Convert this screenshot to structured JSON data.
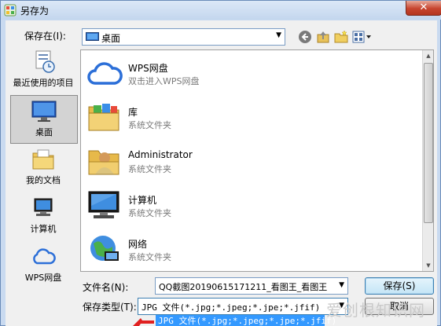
{
  "window": {
    "title": "另存为",
    "close_label": "✕"
  },
  "save_in": {
    "label": "保存在(I):",
    "value": "桌面"
  },
  "toolbar": {
    "back": "back-icon",
    "up": "up-folder-icon",
    "new_folder": "new-folder-icon",
    "view": "view-menu-icon"
  },
  "places": [
    {
      "label": "最近使用的项目",
      "icon": "recent-items-icon"
    },
    {
      "label": "桌面",
      "icon": "desktop-icon",
      "selected": true
    },
    {
      "label": "我的文档",
      "icon": "documents-icon"
    },
    {
      "label": "计算机",
      "icon": "computer-icon"
    },
    {
      "label": "WPS网盘",
      "icon": "wps-cloud-icon"
    }
  ],
  "files": [
    {
      "name": "WPS网盘",
      "desc": "双击进入WPS网盘",
      "icon": "cloud-icon"
    },
    {
      "name": "库",
      "desc": "系统文件夹",
      "icon": "library-icon"
    },
    {
      "name": "Administrator",
      "desc": "系统文件夹",
      "icon": "user-folder-icon"
    },
    {
      "name": "计算机",
      "desc": "系统文件夹",
      "icon": "computer-icon"
    },
    {
      "name": "网络",
      "desc": "系统文件夹",
      "icon": "network-icon"
    }
  ],
  "filename": {
    "label": "文件名(N):",
    "value": "QQ截图20190615171211_看图王_看图王"
  },
  "filetype": {
    "label": "保存类型(T):",
    "value": "JPG 文件(*.jpg;*.jpeg;*.jpe;*.jfif)",
    "dropdown_option": "JPG 文件(*.jpg;*.jpeg;*.jpe;*.jfif)"
  },
  "buttons": {
    "save": "保存(S)",
    "cancel": "取消"
  },
  "watermark": "爱创根知识网",
  "colors": {
    "selection": "#3399ff",
    "close_red": "#c7452f",
    "title_bg": "#c9daf0"
  }
}
